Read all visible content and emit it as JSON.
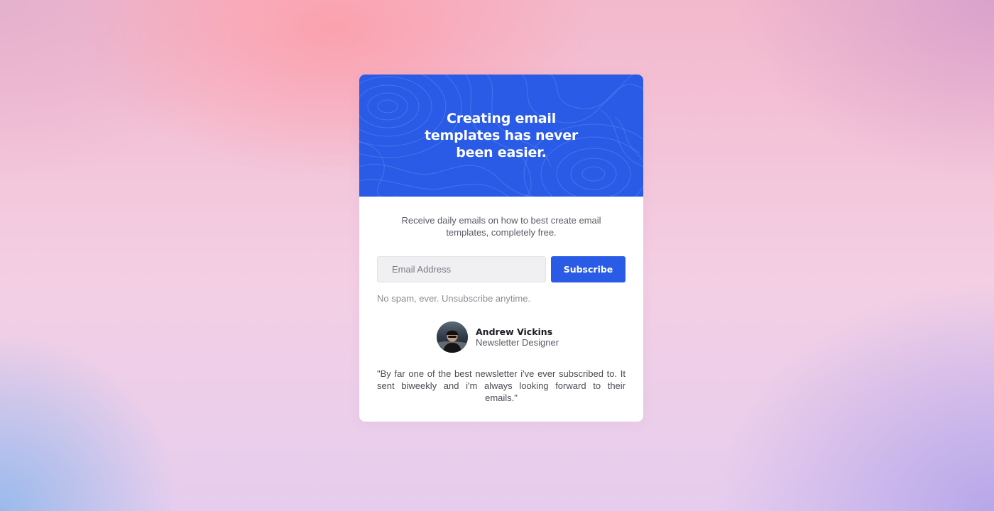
{
  "hero": {
    "title": "Creating email templates has never been easier."
  },
  "intro": {
    "text": "Receive daily emails on how to best create email templates, completely free."
  },
  "form": {
    "email_placeholder": "Email Address",
    "email_value": "",
    "subscribe_label": "Subscribe",
    "note": "No spam, ever. Unsubscribe anytime."
  },
  "testimonial": {
    "name": "Andrew Vickins",
    "role": "Newsletter Designer",
    "quote": "\"By far one of the best newsletter i've ever subscribed to. It sent biweekly and i'm always looking forward to their emails.\""
  },
  "colors": {
    "accent": "#2a5be6",
    "card_background": "#ffffff",
    "input_background": "#f0f0f2",
    "muted_text": "#8b8b94"
  }
}
